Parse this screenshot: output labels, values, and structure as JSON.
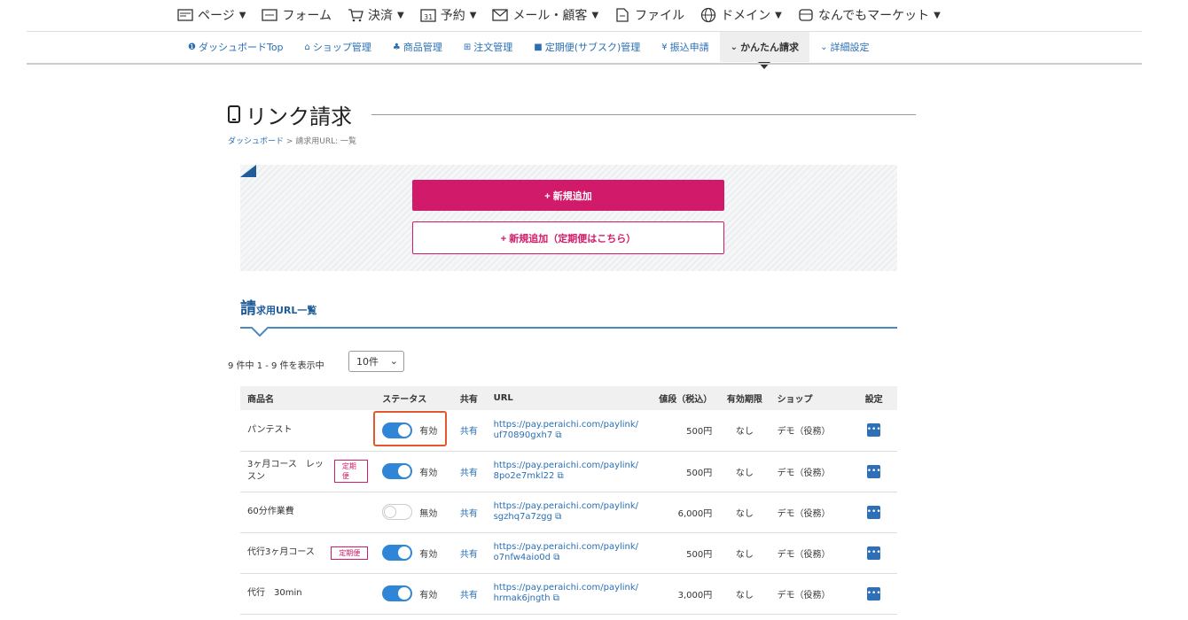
{
  "topnav": [
    {
      "icon": "page-icon",
      "label": "ページ",
      "chev": true
    },
    {
      "icon": "form-icon",
      "label": "フォーム",
      "chev": false
    },
    {
      "icon": "cart-icon",
      "label": "決済",
      "chev": true
    },
    {
      "icon": "calendar-icon",
      "label": "予約",
      "chev": true
    },
    {
      "icon": "mail-icon",
      "label": "メール・顧客",
      "chev": true
    },
    {
      "icon": "file-icon",
      "label": "ファイル",
      "chev": false
    },
    {
      "icon": "globe-icon",
      "label": "ドメイン",
      "chev": true
    },
    {
      "icon": "market-icon",
      "label": "なんでもマーケット",
      "chev": true
    }
  ],
  "subnav": [
    {
      "icon": "❶",
      "label": "ダッシュボードTop",
      "active": false
    },
    {
      "icon": "⌂",
      "label": "ショップ管理",
      "active": false
    },
    {
      "icon": "♣",
      "label": "商品管理",
      "active": false
    },
    {
      "icon": "⊞",
      "label": "注文管理",
      "active": false
    },
    {
      "icon": "■",
      "label": "定期便(サブスク)管理",
      "active": false
    },
    {
      "icon": "¥",
      "label": "振込申請",
      "active": false
    },
    {
      "icon": "⌄",
      "label": "かんたん請求",
      "active": true
    },
    {
      "icon": "⌄",
      "label": "詳細設定",
      "active": false
    }
  ],
  "page": {
    "title": "リンク請求",
    "breadcrumb_home": "ダッシュボード",
    "breadcrumb_sep": " > ",
    "breadcrumb_current": "請求用URL: 一覧"
  },
  "actions": {
    "add_label": "+ 新規追加",
    "add_sub_label": "+ 新規追加（定期便はこちら）"
  },
  "section": {
    "title_big": "請",
    "title_rest": "求用URL一覧"
  },
  "list": {
    "count_text": "9 件中 1 - 9 件を表示中",
    "per_page": "10件"
  },
  "table": {
    "headers": {
      "name": "商品名",
      "status": "ステータス",
      "share": "共有",
      "url": "URL",
      "price": "値段（税込）",
      "expiry": "有効期限",
      "shop": "ショップ",
      "settings": "設定"
    },
    "rows": [
      {
        "name": "パンテスト",
        "tag": "",
        "status_on": true,
        "status": "有効",
        "share": "共有",
        "url1": "https://pay.peraichi.com/paylink/",
        "url2": "uf70890gxh7",
        "price": "500円",
        "expiry": "なし",
        "shop": "デモ（役務）"
      },
      {
        "name": "3ヶ月コース　レッスン",
        "tag": "定期便",
        "status_on": true,
        "status": "有効",
        "share": "共有",
        "url1": "https://pay.peraichi.com/paylink/",
        "url2": "8po2e7mkl22",
        "price": "500円",
        "expiry": "なし",
        "shop": "デモ（役務）"
      },
      {
        "name": "60分作業費",
        "tag": "",
        "status_on": false,
        "status": "無効",
        "share": "共有",
        "url1": "https://pay.peraichi.com/paylink/",
        "url2": "sgzhq7a7zgg",
        "price": "6,000円",
        "expiry": "なし",
        "shop": "デモ（役務）"
      },
      {
        "name": "代行3ヶ月コース",
        "tag": "定期便",
        "status_on": true,
        "status": "有効",
        "share": "共有",
        "url1": "https://pay.peraichi.com/paylink/",
        "url2": "o7nfw4aio0d",
        "price": "500円",
        "expiry": "なし",
        "shop": "デモ（役務）"
      },
      {
        "name": "代行　30min",
        "tag": "",
        "status_on": true,
        "status": "有効",
        "share": "共有",
        "url1": "https://pay.peraichi.com/paylink/",
        "url2": "hrmak6jngth",
        "price": "3,000円",
        "expiry": "なし",
        "shop": "デモ（役務）"
      }
    ]
  },
  "colors": {
    "accent": "#d21a6a",
    "link": "#2a6fb3",
    "toggle_on": "#2f86d6",
    "highlight": "#e4572e"
  }
}
